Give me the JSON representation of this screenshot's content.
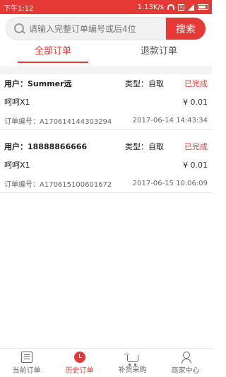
{
  "status_bar": {
    "time": "下午1:12",
    "network_speed": "1.13K/s",
    "box_label": "X"
  },
  "search": {
    "placeholder": "请输入完整订单编号或后4位",
    "button_label": "搜索"
  },
  "tabs": [
    {
      "label": "全部订单",
      "active": true
    },
    {
      "label": "退款订单",
      "active": false
    }
  ],
  "orders": [
    {
      "user_label": "用户：",
      "user_value": "Summer远",
      "type_label": "类型：",
      "type_value": "自取",
      "status": "已完成",
      "item": "呵呵X1",
      "price": "¥ 0.01",
      "no_label": "订单编号：",
      "no_value": "A170614144303294",
      "datetime": "2017-06-14 14:43:34"
    },
    {
      "user_label": "用户：",
      "user_value": "18888866666",
      "type_label": "类型：",
      "type_value": "自取",
      "status": "已完成",
      "item": "呵呵X1",
      "price": "¥ 0.01",
      "no_label": "订单编号：",
      "no_value": "A170615100601672",
      "datetime": "2017-06-15 10:06:09"
    }
  ],
  "bottom_nav": [
    {
      "label": "当前订单",
      "icon": "document-icon",
      "active": false
    },
    {
      "label": "历史订单",
      "icon": "clock-icon",
      "active": true
    },
    {
      "label": "补货采购",
      "icon": "cart-icon",
      "active": false
    },
    {
      "label": "商家中心",
      "icon": "user-icon",
      "active": false
    }
  ],
  "colors": {
    "accent": "#e53935"
  }
}
